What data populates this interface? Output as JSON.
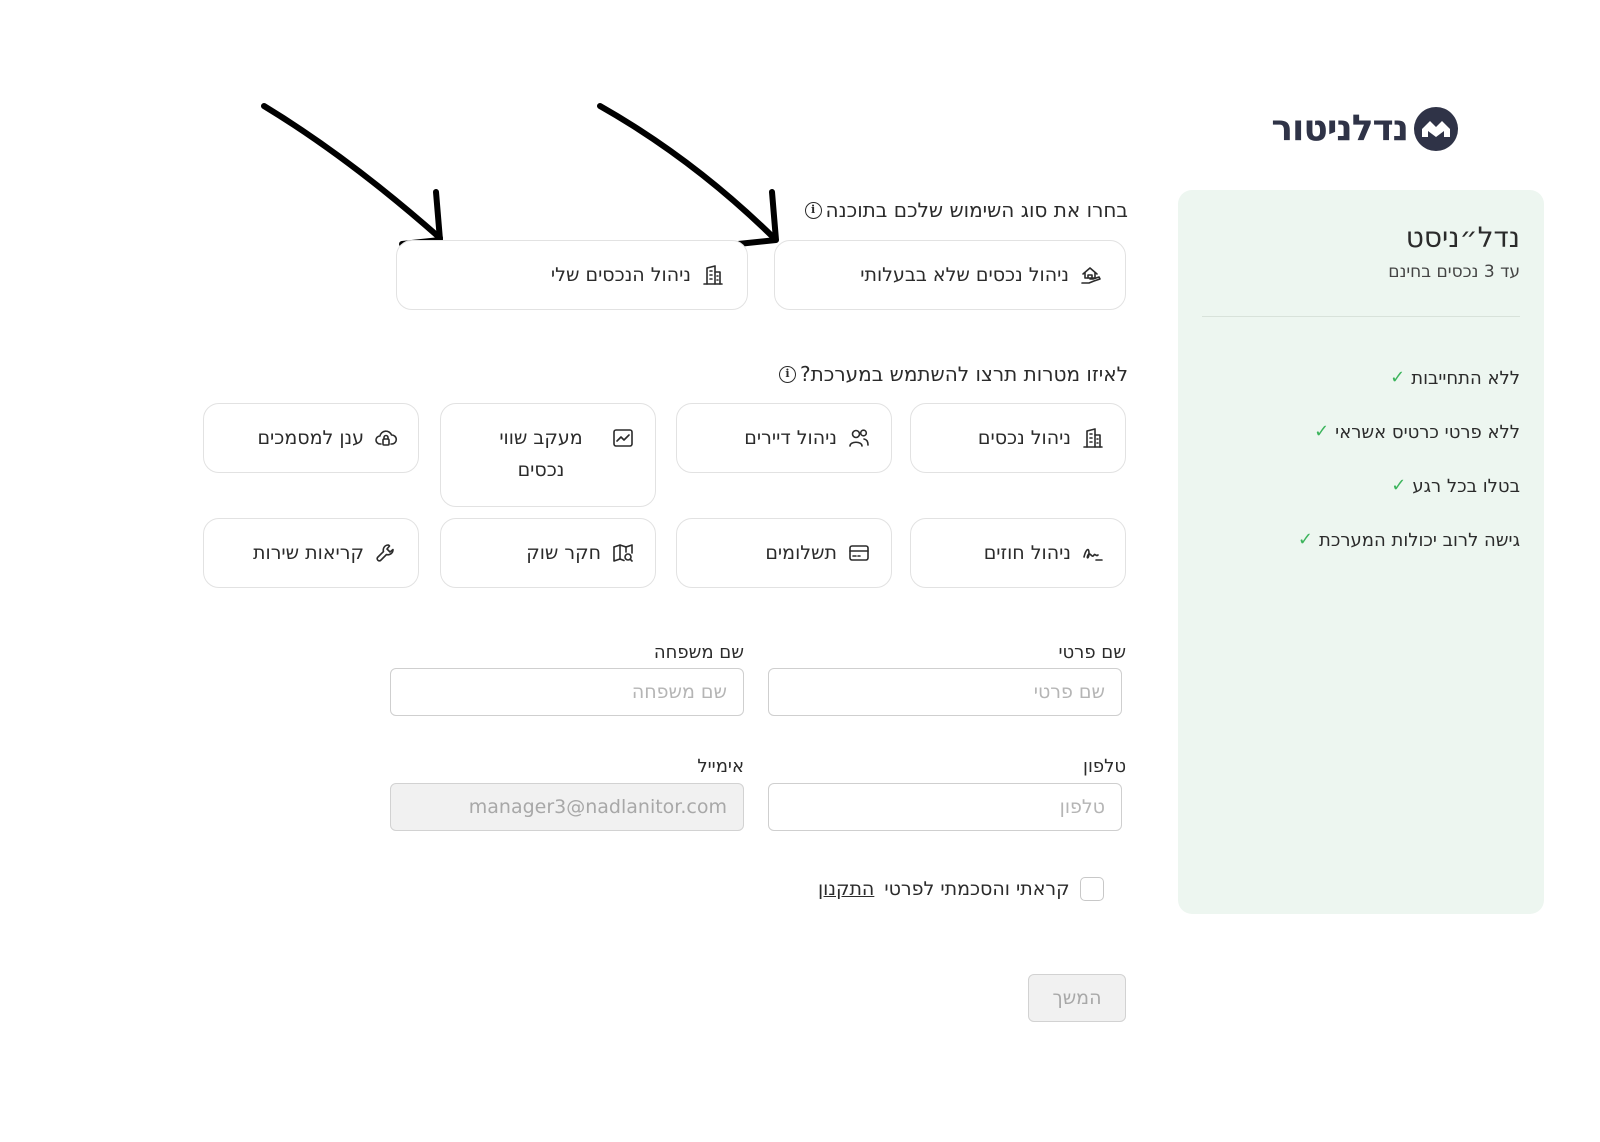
{
  "brand": {
    "name": "נדלניטור",
    "logo_icon": "house-roof-logo-icon"
  },
  "usage_type": {
    "title": "בחרו את סוג השימוש שלכם בתוכנה",
    "options": [
      {
        "label": "ניהול נכסים שלא בבעלותי",
        "icon": "house-hand-icon"
      },
      {
        "label": "ניהול הנכסים שלי",
        "icon": "building-icon"
      }
    ]
  },
  "purposes": {
    "title": "לאיזו מטרות תרצו להשתמש במערכת?",
    "options": [
      {
        "label": "ניהול נכסים",
        "icon": "building-icon"
      },
      {
        "label": "ניהול דיירים",
        "icon": "users-icon"
      },
      {
        "label": "מעקב שווי נכסים",
        "icon": "chart-line-icon"
      },
      {
        "label": "ענן למסמכים",
        "icon": "cloud-lock-icon"
      },
      {
        "label": "ניהול חוזים",
        "icon": "signature-icon"
      },
      {
        "label": "תשלומים",
        "icon": "credit-card-icon"
      },
      {
        "label": "חקר שוק",
        "icon": "map-search-icon"
      },
      {
        "label": "קריאות שירות",
        "icon": "wrench-icon"
      }
    ]
  },
  "form": {
    "first_name": {
      "label": "שם פרטי",
      "placeholder": "שם פרטי"
    },
    "last_name": {
      "label": "שם משפחה",
      "placeholder": "שם משפחה"
    },
    "phone": {
      "label": "טלפון",
      "placeholder": "טלפון"
    },
    "email": {
      "label": "אימייל",
      "value": "manager3@nadlanitor.com"
    }
  },
  "terms": {
    "text": "קראתי והסכמתי לפרטי",
    "link": "התקנון"
  },
  "continue_label": "המשך",
  "plan": {
    "title": "נדל״ניסט",
    "subtitle": "עד 3 נכסים בחינם",
    "features": [
      "ללא התחייבות",
      "ללא פרטי כרטיס אשראי",
      "בטלו בכל רגע",
      "גישה לרוב יכולות המערכת"
    ],
    "check_color": "#3cb45c",
    "background_color": "#edf6f0"
  }
}
